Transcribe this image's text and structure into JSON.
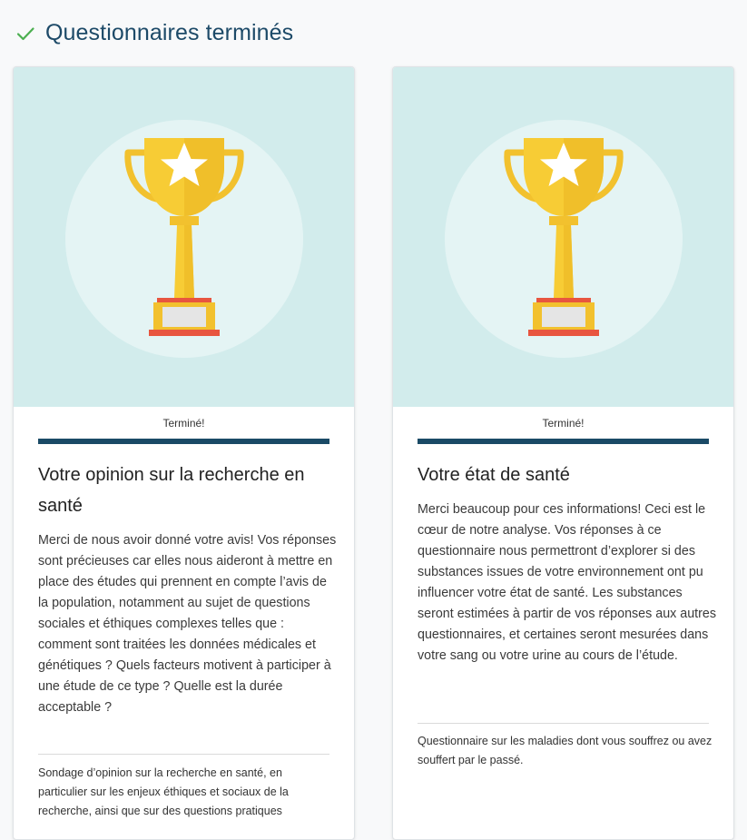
{
  "section": {
    "title": "Questionnaires terminés",
    "icon": "check-icon",
    "accent_color": "#1d4a68",
    "check_color": "#4caf50"
  },
  "cards": [
    {
      "image_icon": "trophy-icon",
      "status": "Terminé!",
      "progress": 1.0,
      "title": "Votre opinion sur la recherche en santé",
      "description": "Merci de nous avoir donné votre avis! Vos réponses sont précieuses car elles nous aideront à mettre en place des études qui prennent en compte l’avis de la population, notamment au sujet de questions sociales et éthiques complexes telles que : comment sont traitées les données médicales et génétiques ? Quels facteurs motivent à participer à une étude de ce type ? Quelle est la durée acceptable ?",
      "footer": "Sondage d’opinion sur la recherche en santé, en particulier sur les enjeux éthiques et sociaux de la recherche, ainsi que sur des questions pratiques"
    },
    {
      "image_icon": "trophy-icon",
      "status": "Terminé!",
      "progress": 1.0,
      "title": "Votre état de santé",
      "description": "Merci beaucoup pour ces informations! Ceci est le cœur de notre analyse. Vos réponses à ce questionnaire nous permettront d’explorer si des substances issues de votre environnement ont pu influencer votre état de santé. Les substances seront estimées à partir de vos réponses aux autres questionnaires, et certaines seront mesurées dans votre sang ou votre urine au cours de l’étude.",
      "footer": "Questionnaire sur les maladies dont vous souffrez ou avez souffert par le passé."
    }
  ]
}
